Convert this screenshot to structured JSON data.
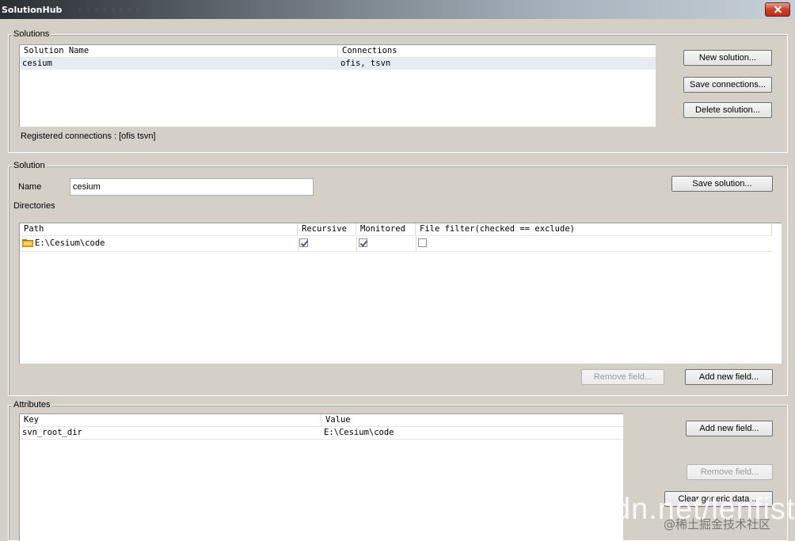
{
  "window": {
    "title": "SolutionHub",
    "title_suffix": "  ·  ·  ·  ·  ·  ·  ·  ·"
  },
  "solutions": {
    "group_label": "Solutions",
    "columns": [
      "Solution Name",
      "Connections"
    ],
    "rows": [
      {
        "name": "cesium",
        "connections": "ofis, tsvn"
      }
    ],
    "registered": "Registered connections : [ofis tsvn]",
    "buttons": {
      "new": "New solution...",
      "save_connections": "Save connections...",
      "delete": "Delete solution..."
    }
  },
  "solution": {
    "group_label": "Solution",
    "name_label": "Name",
    "name_value": "cesium",
    "save_button": "Save solution..."
  },
  "directories": {
    "group_label": "Directories",
    "columns": [
      "Path",
      "Recursive",
      "Monitored",
      "File filter(checked == exclude)"
    ],
    "rows": [
      {
        "path": "E:\\Cesium\\code",
        "recursive": true,
        "monitored": true,
        "file_filter": false
      }
    ],
    "remove_button": "Remove field...",
    "add_button": "Add new field..."
  },
  "attributes": {
    "group_label": "Attributes",
    "columns": [
      "Key",
      "Value"
    ],
    "rows": [
      {
        "key": "svn_root_dir",
        "value": "E:\\Cesium\\code"
      }
    ],
    "add_button": "Add new field...",
    "remove_button": "Remove field...",
    "clear_button": "Clear generic data ..."
  },
  "watermark": {
    "text": "dn.net/lenfist",
    "subtext": "@稀土掘金技术社区"
  },
  "colors": {
    "window_bg": "#d4d0c8",
    "selected_row": "#e8ebef",
    "close_button": "#c8412b"
  }
}
